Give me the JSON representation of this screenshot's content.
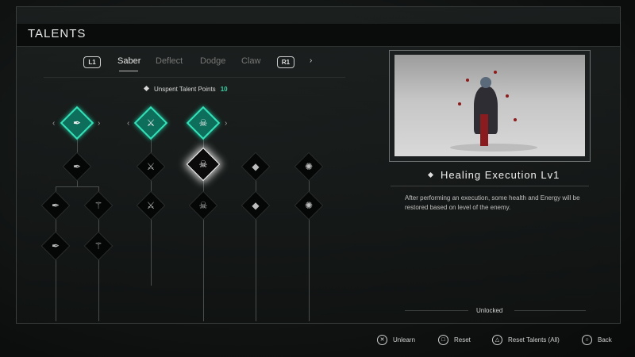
{
  "header": {
    "title": "TALENTS"
  },
  "tabs": {
    "left_button": "L1",
    "right_button": "R1",
    "items": [
      "Saber",
      "Deflect",
      "Dodge",
      "Claw"
    ],
    "active": "Saber",
    "next_arrow": "›"
  },
  "points": {
    "label": "Unspent Talent Points",
    "value": "10"
  },
  "tree": {
    "glyphs": {
      "raven": "✒",
      "blade": "⚔",
      "skull": "☠",
      "block": "◆",
      "spiral": "✺",
      "claw": "⚚"
    }
  },
  "detail": {
    "skill_name": "Healing Execution Lv1",
    "description": "After performing an execution, some health and Energy will be restored based on level of the enemy.",
    "status": "Unlocked"
  },
  "footer": {
    "hints": [
      {
        "icon": "✕",
        "label": "Unlearn"
      },
      {
        "icon": "□",
        "label": "Reset"
      },
      {
        "icon": "△",
        "label": "Reset Talents (All)"
      },
      {
        "icon": "○",
        "label": "Back"
      }
    ]
  },
  "colors": {
    "accent": "#34e0b8",
    "active_fill": "#0e6e5c",
    "points_value": "#39d0a4"
  }
}
